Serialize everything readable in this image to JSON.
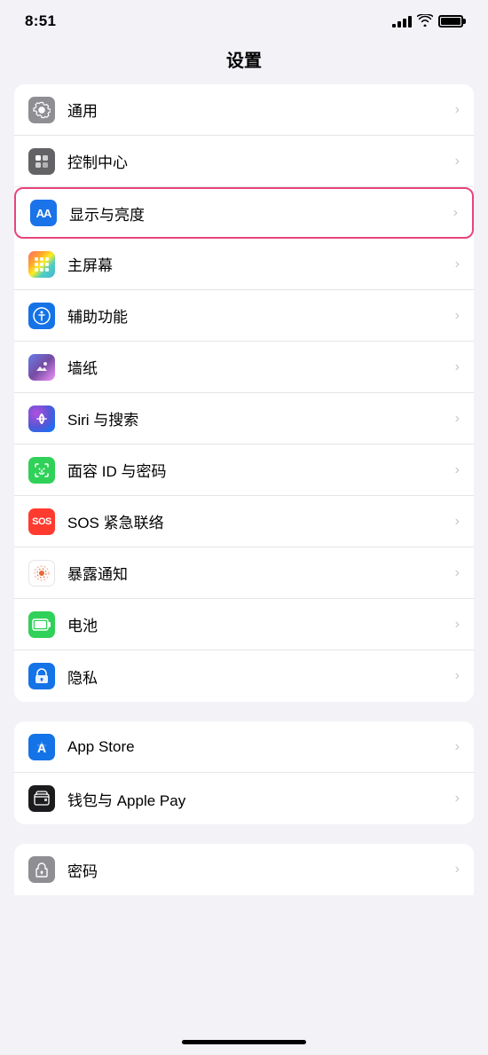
{
  "statusBar": {
    "time": "8:51",
    "signal": "signal",
    "wifi": "wifi",
    "battery": "battery"
  },
  "pageTitle": "设置",
  "sections": [
    {
      "id": "section1",
      "items": [
        {
          "id": "general",
          "label": "通用",
          "icon": "gear",
          "iconBg": "icon-gray",
          "highlighted": false
        },
        {
          "id": "control-center",
          "label": "控制中心",
          "icon": "control",
          "iconBg": "icon-gray2",
          "highlighted": false
        },
        {
          "id": "display",
          "label": "显示与亮度",
          "icon": "aa",
          "iconBg": "icon-blue",
          "highlighted": true
        },
        {
          "id": "home-screen",
          "label": "主屏幕",
          "icon": "grid",
          "iconBg": "icon-grid",
          "highlighted": false
        },
        {
          "id": "accessibility",
          "label": "辅助功能",
          "icon": "access",
          "iconBg": "icon-access",
          "highlighted": false
        },
        {
          "id": "wallpaper",
          "label": "墙纸",
          "icon": "wallpaper",
          "iconBg": "icon-wallpaper",
          "highlighted": false
        },
        {
          "id": "siri",
          "label": "Siri 与搜索",
          "icon": "siri",
          "iconBg": "icon-siri",
          "highlighted": false
        },
        {
          "id": "faceid",
          "label": "面容 ID 与密码",
          "icon": "faceid",
          "iconBg": "icon-faceid",
          "highlighted": false
        },
        {
          "id": "sos",
          "label": "SOS 紧急联络",
          "icon": "sos",
          "iconBg": "icon-sos",
          "highlighted": false
        },
        {
          "id": "exposure",
          "label": "暴露通知",
          "icon": "exposure",
          "iconBg": "icon-exposure",
          "highlighted": false
        },
        {
          "id": "battery",
          "label": "电池",
          "icon": "battery",
          "iconBg": "icon-battery",
          "highlighted": false
        },
        {
          "id": "privacy",
          "label": "隐私",
          "icon": "privacy",
          "iconBg": "icon-privacy",
          "highlighted": false
        }
      ]
    },
    {
      "id": "section2",
      "items": [
        {
          "id": "appstore",
          "label": "App Store",
          "icon": "appstore",
          "iconBg": "icon-appstore",
          "highlighted": false
        },
        {
          "id": "wallet",
          "label": "钱包与 Apple Pay",
          "icon": "wallet",
          "iconBg": "icon-wallet",
          "highlighted": false
        }
      ]
    },
    {
      "id": "section3",
      "items": [
        {
          "id": "password",
          "label": "密码",
          "icon": "password",
          "iconBg": "icon-password",
          "highlighted": false
        }
      ]
    }
  ]
}
